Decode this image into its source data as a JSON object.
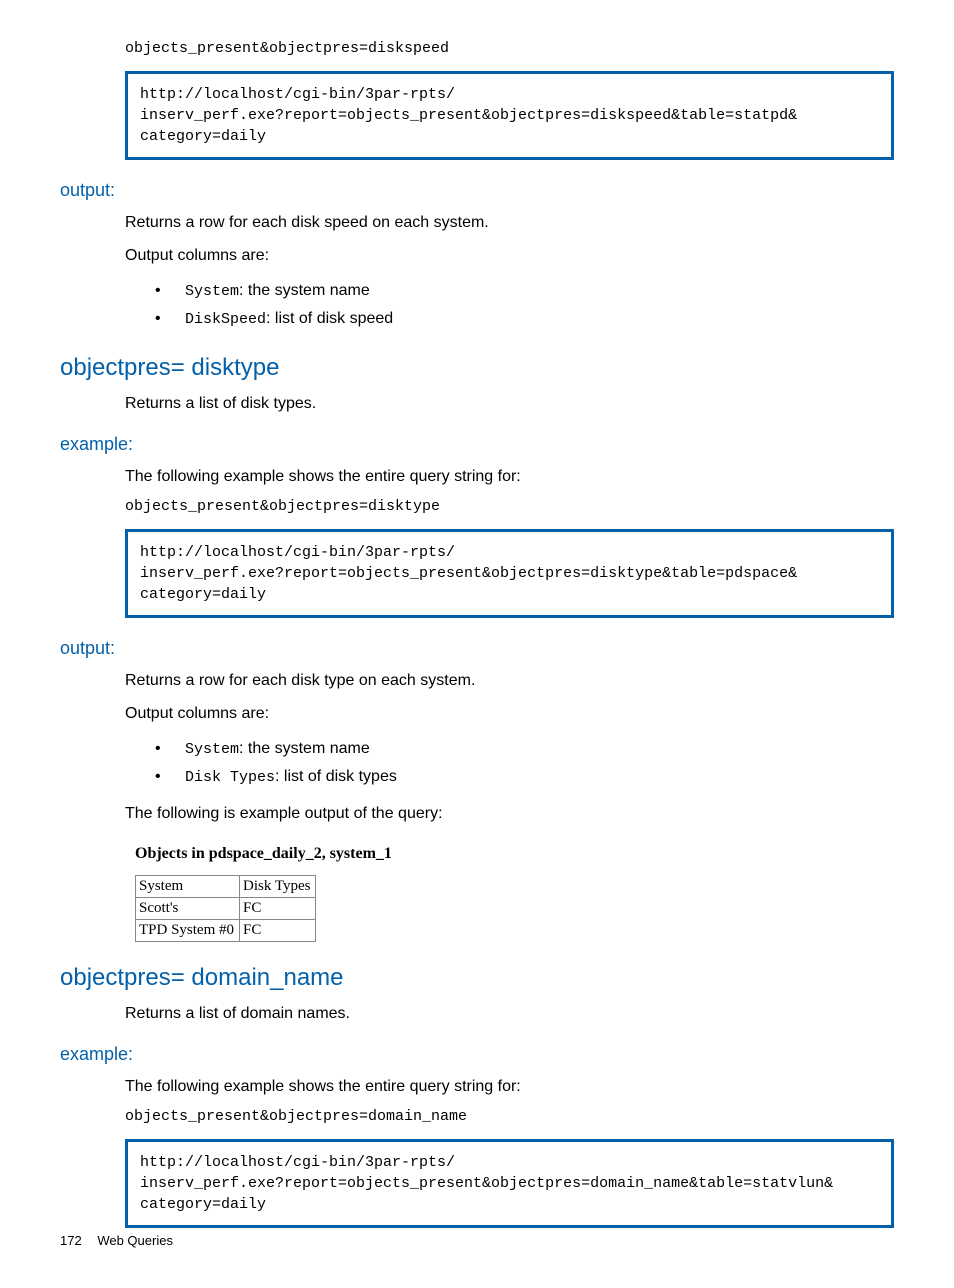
{
  "diskspeed": {
    "query_line": "objects_present&objectpres=diskspeed",
    "code": "http://localhost/cgi-bin/3par-rpts/\ninserv_perf.exe?report=objects_present&objectpres=diskspeed&table=statpd&\ncategory=daily",
    "output_heading": "output:",
    "output_desc1": "Returns a row for each disk speed on each system.",
    "output_desc2": "Output columns are:",
    "bullets": [
      {
        "code": "System",
        "text": ": the system name"
      },
      {
        "code": "DiskSpeed",
        "text": ": list of disk speed"
      }
    ]
  },
  "disktype": {
    "heading": "objectpres= disktype",
    "intro": "Returns a list of disk types.",
    "example_heading": "example:",
    "example_desc": "The following example shows the entire query string for:",
    "query_line": "objects_present&objectpres=disktype",
    "code": "http://localhost/cgi-bin/3par-rpts/\ninserv_perf.exe?report=objects_present&objectpres=disktype&table=pdspace&\ncategory=daily",
    "output_heading": "output:",
    "output_desc1": "Returns a row for each disk type on each system.",
    "output_desc2": "Output columns are:",
    "bullets": [
      {
        "code": "System",
        "text": ": the system name"
      },
      {
        "code": "Disk Types",
        "text": ": list of disk types"
      }
    ],
    "output_desc3": "The following is example output of the query:",
    "table_title": "Objects in pdspace_daily_2, system_1",
    "table": {
      "headers": [
        "System",
        "Disk Types"
      ],
      "rows": [
        [
          "Scott's",
          "FC"
        ],
        [
          "TPD System #0",
          "FC"
        ]
      ]
    }
  },
  "domainname": {
    "heading": "objectpres= domain_name",
    "intro": "Returns a list of domain names.",
    "example_heading": "example:",
    "example_desc": "The following example shows the entire query string for:",
    "query_line": "objects_present&objectpres=domain_name",
    "code": "http://localhost/cgi-bin/3par-rpts/\ninserv_perf.exe?report=objects_present&objectpres=domain_name&table=statvlun&\ncategory=daily"
  },
  "footer": {
    "page": "172",
    "label": "Web Queries"
  }
}
